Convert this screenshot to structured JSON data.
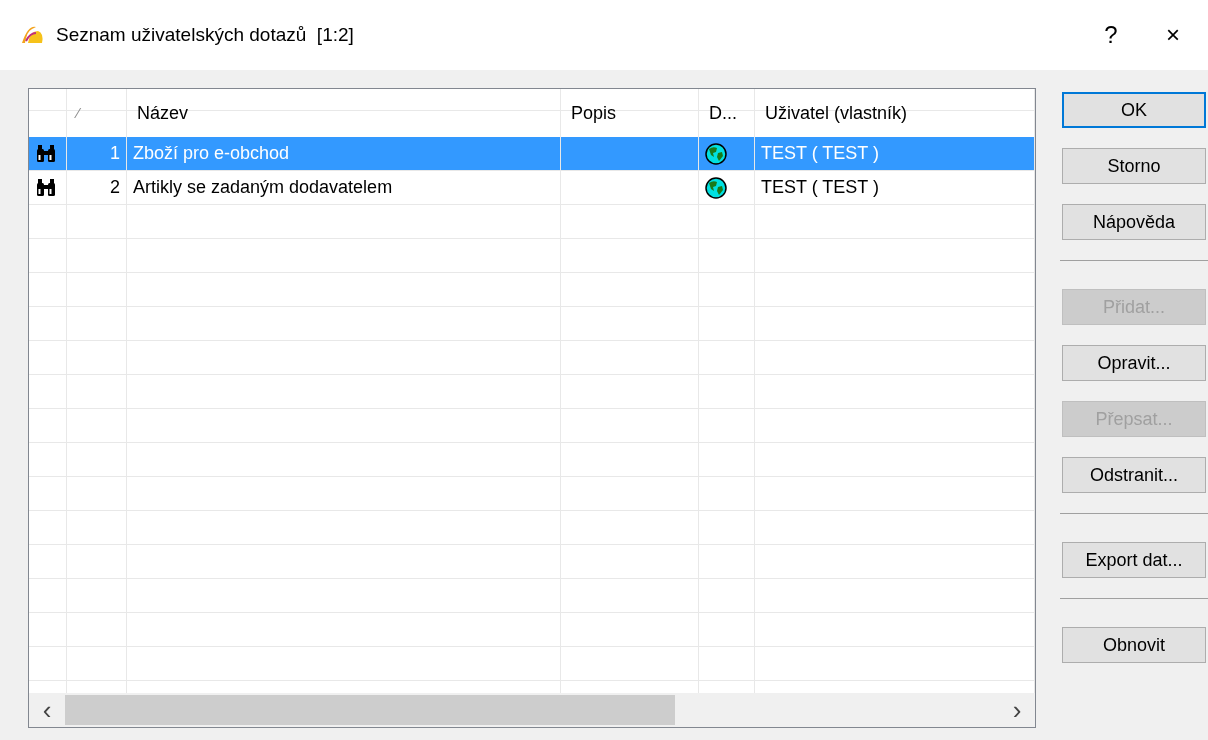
{
  "window": {
    "title": "Seznam uživatelských dotazů  [1:2]",
    "help": "?",
    "close": "×"
  },
  "table": {
    "columns": [
      "",
      "⁄",
      "Název",
      "Popis",
      "D...",
      "Uživatel (vlastník)"
    ],
    "rows": [
      {
        "number": "1",
        "name": "Zboží pro e-obchod",
        "description": "",
        "owner": "TEST ( TEST )",
        "selected": true
      },
      {
        "number": "2",
        "name": "Artikly se zadaným dodavatelem",
        "description": "",
        "owner": "TEST ( TEST )",
        "selected": false
      }
    ],
    "scroll_left": "‹",
    "scroll_right": "›"
  },
  "buttons": [
    {
      "kind": "button",
      "label": "OK",
      "disabled": false,
      "default": true
    },
    {
      "kind": "button",
      "label": "Storno",
      "disabled": false,
      "default": false
    },
    {
      "kind": "button",
      "label": "Nápověda",
      "disabled": false,
      "default": false
    },
    {
      "kind": "separator"
    },
    {
      "kind": "button",
      "label": "Přidat...",
      "disabled": true,
      "default": false
    },
    {
      "kind": "button",
      "label": "Opravit...",
      "disabled": false,
      "default": false
    },
    {
      "kind": "button",
      "label": "Přepsat...",
      "disabled": true,
      "default": false
    },
    {
      "kind": "button",
      "label": "Odstranit...",
      "disabled": false,
      "default": false
    },
    {
      "kind": "separator"
    },
    {
      "kind": "button",
      "label": "Export dat...",
      "disabled": false,
      "default": false
    },
    {
      "kind": "separator"
    },
    {
      "kind": "button",
      "label": "Obnovit",
      "disabled": false,
      "default": false
    }
  ]
}
